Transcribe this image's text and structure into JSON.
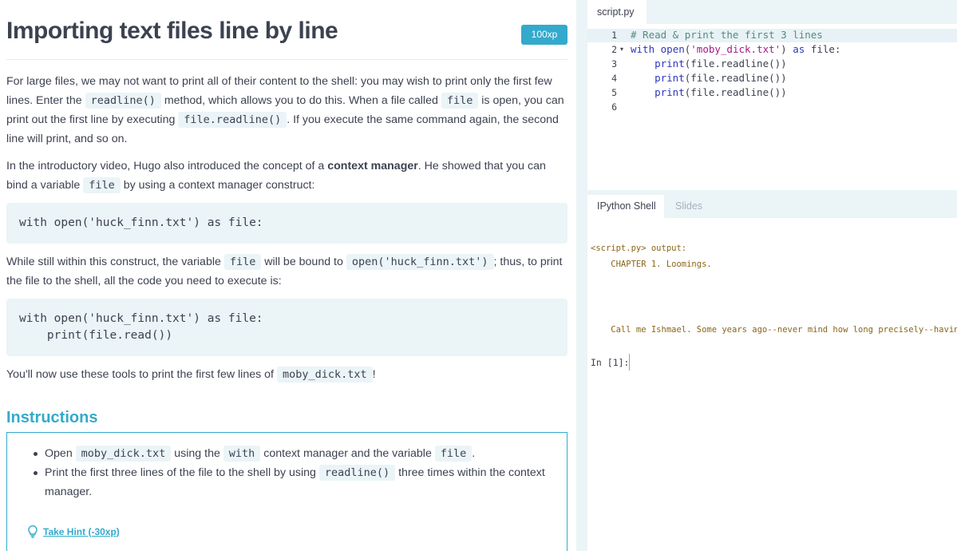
{
  "header": {
    "title": "Importing text files line by line",
    "xp": "100xp"
  },
  "paragraphs": {
    "p1": {
      "t1": "For large files, we may not want to print all of their content to the shell: you may wish to print only the first few lines. Enter the ",
      "c1": "readline()",
      "t2": " method, which allows you to do this. When a file called ",
      "c2": "file",
      "t3": " is open, you can print out the first line by executing ",
      "c3": "file.readline()",
      "t4": ". If you execute the same command again, the second line will print, and so on."
    },
    "p2": {
      "t1": "In the introductory video, Hugo also introduced the concept of a ",
      "bold": "context manager",
      "t2": ". He showed that you can bind a variable ",
      "c1": "file",
      "t3": " by using a context manager construct:"
    },
    "code1": "with open('huck_finn.txt') as file:",
    "p3": {
      "t1": "While still within this construct, the variable ",
      "c1": "file",
      "t2": " will be bound to ",
      "c2": "open('huck_finn.txt')",
      "t3": "; thus, to print the file to the shell, all the code you need to execute is:"
    },
    "code2": {
      "l1": "with open('huck_finn.txt') as file:",
      "l2": "    print(file.read())"
    },
    "p4": {
      "t1": "You'll now use these tools to print the first few lines of ",
      "c1": "moby_dick.txt",
      "t2": "!"
    }
  },
  "instructions": {
    "title": "Instructions",
    "b1": {
      "t1": "Open ",
      "c1": "moby_dick.txt",
      "t2": " using the ",
      "c2": "with",
      "t3": " context manager and the variable ",
      "c3": "file",
      "t4": "."
    },
    "b2": {
      "t1": "Print the first three lines of the file to the shell by using ",
      "c1": "readline()",
      "t2": " three times within the context manager."
    },
    "hint": "Take Hint (-30xp)"
  },
  "editor": {
    "tab": "script.py",
    "line_numbers": [
      "1",
      "2",
      "3",
      "4",
      "5",
      "6"
    ],
    "fold_marker": "▾",
    "lines": {
      "l1": "# Read & print the first 3 lines",
      "l2_kw": "with ",
      "l2_fn": "open",
      "l2_p1": "(",
      "l2_str": "'moby_dick.txt'",
      "l2_p2": ") ",
      "l2_kw2": "as",
      "l2_p3": " file:",
      "indent": "    ",
      "print_fn": "print",
      "print_args": "(file.readline())"
    }
  },
  "shell": {
    "tab_active": "IPython Shell",
    "tab_inactive": "Slides",
    "output_header": "<script.py> output:",
    "out1": "    CHAPTER 1. Loomings.",
    "out2": "    Call me Ishmael. Some years ago--never mind how long precisely--having",
    "prompt": "In [1]:"
  }
}
